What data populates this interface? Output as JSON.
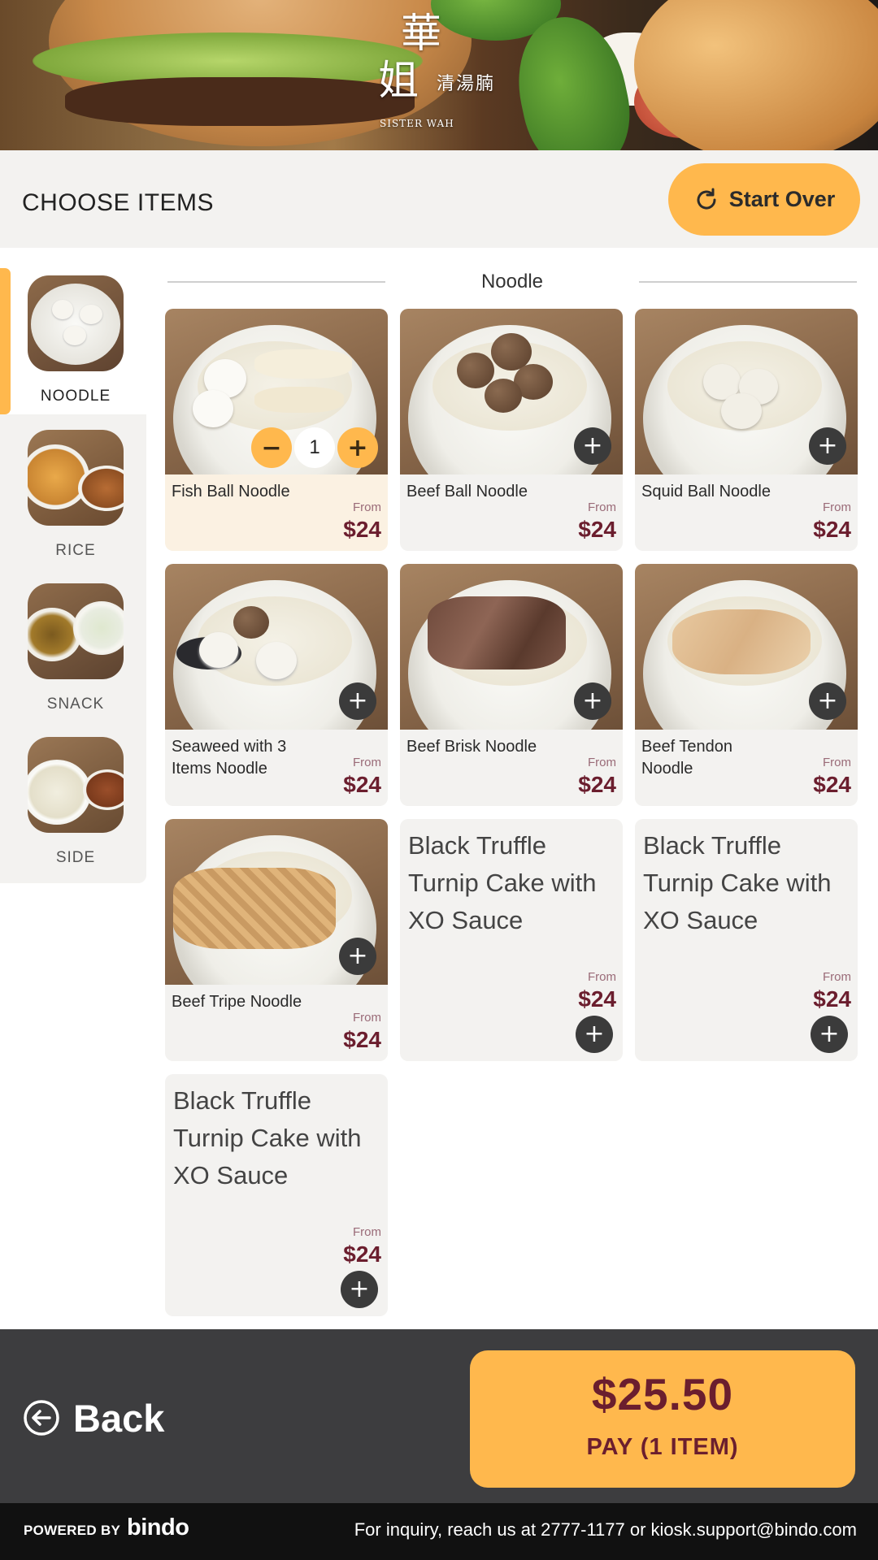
{
  "logo": {
    "chinese_big_1": "華",
    "chinese_big_2": "姐",
    "chinese_small": "清湯腩",
    "english": "SISTER WAH"
  },
  "header": {
    "title": "CHOOSE ITEMS",
    "start_over_label": "Start Over"
  },
  "sidebar": {
    "items": [
      {
        "label": "NOODLE",
        "active": true
      },
      {
        "label": "RICE",
        "active": false
      },
      {
        "label": "SNACK",
        "active": false
      },
      {
        "label": "SIDE",
        "active": false
      }
    ]
  },
  "section": {
    "title": "Noodle"
  },
  "products": [
    {
      "name": "Fish Ball Noodle",
      "from": "From",
      "price": "$24",
      "quantity": "1",
      "selected": true
    },
    {
      "name": "Beef Ball Noodle",
      "from": "From",
      "price": "$24"
    },
    {
      "name": "Squid Ball Noodle",
      "from": "From",
      "price": "$24"
    },
    {
      "name": "Seaweed with 3 Items Noodle",
      "from": "From",
      "price": "$24"
    },
    {
      "name": "Beef Brisk Noodle",
      "from": "From",
      "price": "$24"
    },
    {
      "name": "Beef Tendon Noodle",
      "from": "From",
      "price": "$24"
    },
    {
      "name": "Beef Tripe Noodle",
      "from": "From",
      "price": "$24"
    },
    {
      "name": "Black Truffle Turnip Cake with XO Sauce",
      "from": "From",
      "price": "$24"
    },
    {
      "name": "Black Truffle Turnip Cake with XO Sauce",
      "from": "From",
      "price": "$24"
    },
    {
      "name": "Black Truffle Turnip Cake with XO Sauce",
      "from": "From",
      "price": "$24"
    }
  ],
  "icons": {
    "add": "+",
    "minus": "−",
    "plus": "+"
  },
  "footer": {
    "back_label": "Back",
    "pay_amount": "$25.50",
    "pay_label": "PAY (1 ITEM)"
  },
  "bottom_bar": {
    "powered_by": "POWERED BY",
    "brand": "bindo",
    "inquiry": "For inquiry, reach us at 2777-1177 or  kiosk.support@bindo.com"
  },
  "colors": {
    "accent": "#ffb84d",
    "price": "#6b1e2e",
    "footer_bg": "#3d3d3f",
    "bottom_bar_bg": "#111111"
  }
}
